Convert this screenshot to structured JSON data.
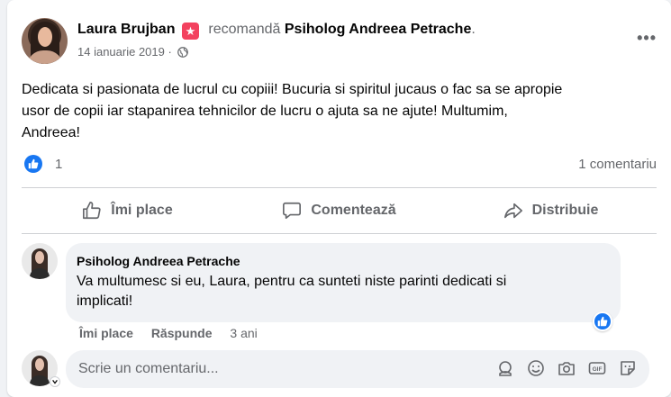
{
  "post": {
    "author": "Laura Brujban",
    "recommends": "recomandă",
    "page": "Psiholog Andreea Petrache",
    "page_suffix": ".",
    "date": "14 ianuarie 2019",
    "date_sep": "·",
    "text_lines": [
      "Dedicata si pasionata de lucrul cu copiii! Bucuria si spiritul jucaus o fac sa se apropie",
      "usor de copii iar stapanirea tehnicilor de lucru o ajuta sa ne ajute! Multumim,",
      "Andreea!"
    ],
    "like_count": "1",
    "comment_count": "1 comentariu"
  },
  "actions": {
    "like": "Îmi place",
    "comment": "Comentează",
    "share": "Distribuie"
  },
  "comment": {
    "author": "Psiholog Andreea Petrache",
    "text_lines": [
      "Va multumesc si eu, Laura, pentru ca sunteti niste parinti dedicati si",
      "implicati!"
    ],
    "like": "Îmi place",
    "reply": "Răspunde",
    "time": "3 ani"
  },
  "composer": {
    "placeholder": "Scrie un comentariu..."
  },
  "icons": {
    "recommend": "recommend-star-icon",
    "privacy": "globe-icon",
    "more": "more-options-icon",
    "like": "thumbs-up-icon",
    "comment": "comment-bubble-icon",
    "share": "share-arrow-icon",
    "emoji_sticker": "avatar-sticker-icon",
    "emoji": "emoji-icon",
    "camera": "camera-icon",
    "gif": "gif-icon",
    "sticker": "sticker-icon"
  },
  "colors": {
    "accent": "#1877f2",
    "recommend": "#f3425f",
    "secondary_text": "#65676b"
  }
}
